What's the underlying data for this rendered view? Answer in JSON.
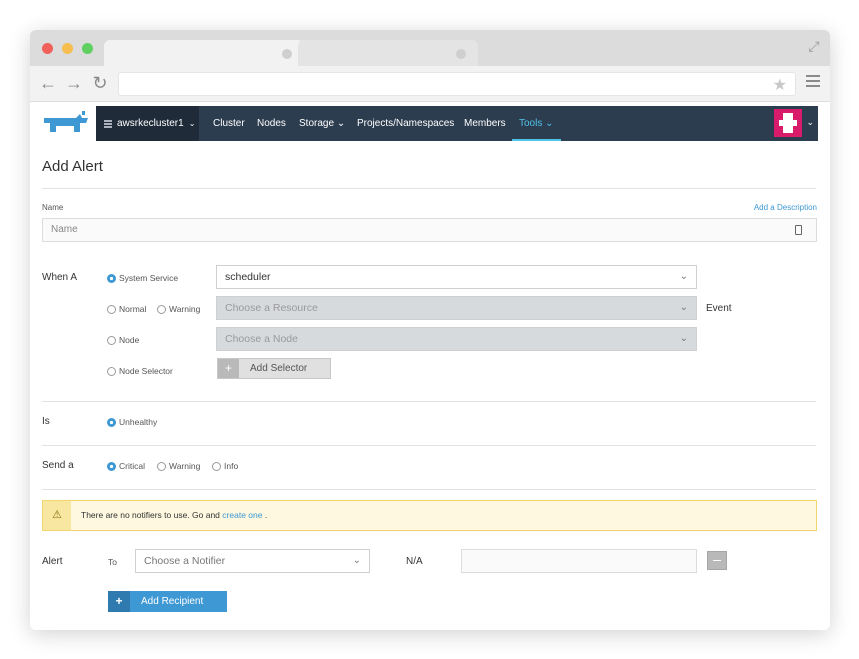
{
  "browser": {
    "star_glyph": "★",
    "expand_glyph": "⤢",
    "back_glyph": "←",
    "forward_glyph": "→",
    "reload_glyph": "↻"
  },
  "header": {
    "cluster_name": "awsrkecluster1",
    "nav": [
      "Cluster",
      "Nodes",
      "Storage",
      "Projects/Namespaces",
      "Members",
      "Tools"
    ],
    "active_nav": "Tools",
    "accent_color": "#4fc3e8",
    "nav_bg": "#2d3d50"
  },
  "page": {
    "title": "Add Alert",
    "name_label": "Name",
    "add_description": "Add a Description",
    "name_placeholder": "Name"
  },
  "when": {
    "label": "When A",
    "options": {
      "system_service": "System Service",
      "normal": "Normal",
      "warning": "Warning",
      "node": "Node",
      "node_selector": "Node Selector"
    },
    "service_value": "scheduler",
    "resource_placeholder": "Choose a Resource",
    "event_label": "Event",
    "node_placeholder": "Choose a Node",
    "add_selector": "Add Selector"
  },
  "is": {
    "label": "Is",
    "option": "Unhealthy"
  },
  "send": {
    "label": "Send a",
    "options": [
      "Critical",
      "Warning",
      "Info"
    ],
    "selected": "Critical"
  },
  "warning": {
    "text": "There are no notifiers to use. Go and",
    "link": "create one",
    "suffix": "."
  },
  "alert": {
    "label": "Alert",
    "to_label": "To",
    "notifier_placeholder": "Choose a Notifier",
    "na_label": "N/A",
    "add_recipient": "Add Recipient"
  }
}
